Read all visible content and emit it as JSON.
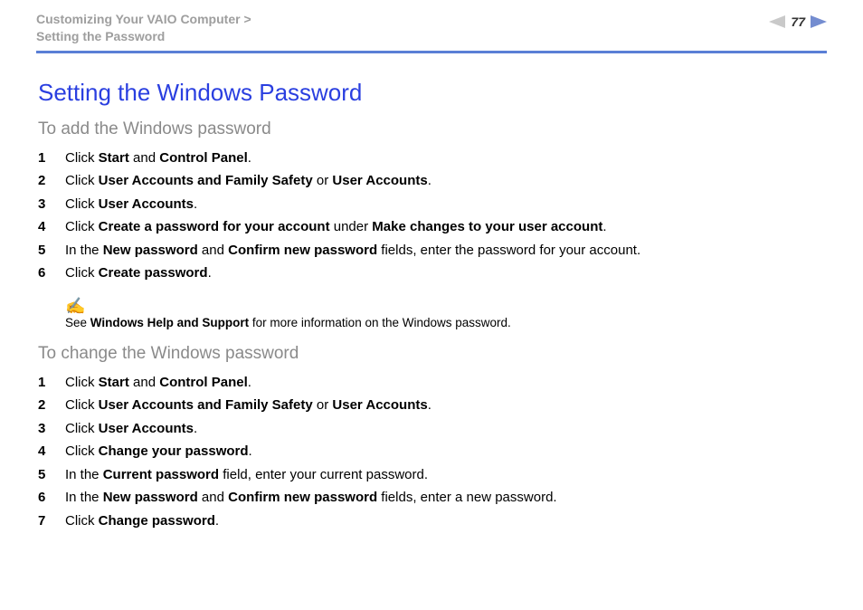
{
  "header": {
    "breadcrumb_line1": "Customizing Your VAIO Computer",
    "breadcrumb_line2": "Setting the Password",
    "page_number": "77"
  },
  "main": {
    "title": "Setting the Windows Password",
    "section_add": {
      "heading": "To add the Windows password",
      "steps": [
        [
          {
            "t": "Click "
          },
          {
            "t": "Start",
            "b": true
          },
          {
            "t": " and "
          },
          {
            "t": "Control Panel",
            "b": true
          },
          {
            "t": "."
          }
        ],
        [
          {
            "t": "Click "
          },
          {
            "t": "User Accounts and Family Safety",
            "b": true
          },
          {
            "t": " or "
          },
          {
            "t": "User Accounts",
            "b": true
          },
          {
            "t": "."
          }
        ],
        [
          {
            "t": "Click "
          },
          {
            "t": "User Accounts",
            "b": true
          },
          {
            "t": "."
          }
        ],
        [
          {
            "t": "Click "
          },
          {
            "t": "Create a password for your account",
            "b": true
          },
          {
            "t": " under "
          },
          {
            "t": "Make changes to your user account",
            "b": true
          },
          {
            "t": "."
          }
        ],
        [
          {
            "t": "In the "
          },
          {
            "t": "New password",
            "b": true
          },
          {
            "t": " and "
          },
          {
            "t": "Confirm new password",
            "b": true
          },
          {
            "t": " fields, enter the password for your account."
          }
        ],
        [
          {
            "t": "Click "
          },
          {
            "t": "Create password",
            "b": true
          },
          {
            "t": "."
          }
        ]
      ],
      "note": [
        {
          "t": "See "
        },
        {
          "t": "Windows Help and Support",
          "b": true
        },
        {
          "t": " for more information on the Windows password."
        }
      ]
    },
    "section_change": {
      "heading": "To change the Windows password",
      "steps": [
        [
          {
            "t": "Click "
          },
          {
            "t": "Start",
            "b": true
          },
          {
            "t": " and "
          },
          {
            "t": "Control Panel",
            "b": true
          },
          {
            "t": "."
          }
        ],
        [
          {
            "t": "Click "
          },
          {
            "t": "User Accounts and Family Safety",
            "b": true
          },
          {
            "t": " or "
          },
          {
            "t": "User Accounts",
            "b": true
          },
          {
            "t": "."
          }
        ],
        [
          {
            "t": "Click "
          },
          {
            "t": "User Accounts",
            "b": true
          },
          {
            "t": "."
          }
        ],
        [
          {
            "t": "Click "
          },
          {
            "t": "Change your password",
            "b": true
          },
          {
            "t": "."
          }
        ],
        [
          {
            "t": "In the "
          },
          {
            "t": "Current password",
            "b": true
          },
          {
            "t": " field, enter your current password."
          }
        ],
        [
          {
            "t": "In the "
          },
          {
            "t": "New password",
            "b": true
          },
          {
            "t": " and "
          },
          {
            "t": "Confirm new password",
            "b": true
          },
          {
            "t": " fields, enter a new password."
          }
        ],
        [
          {
            "t": "Click "
          },
          {
            "t": "Change password",
            "b": true
          },
          {
            "t": "."
          }
        ]
      ]
    }
  },
  "icons": {
    "note_glyph": "✍"
  }
}
